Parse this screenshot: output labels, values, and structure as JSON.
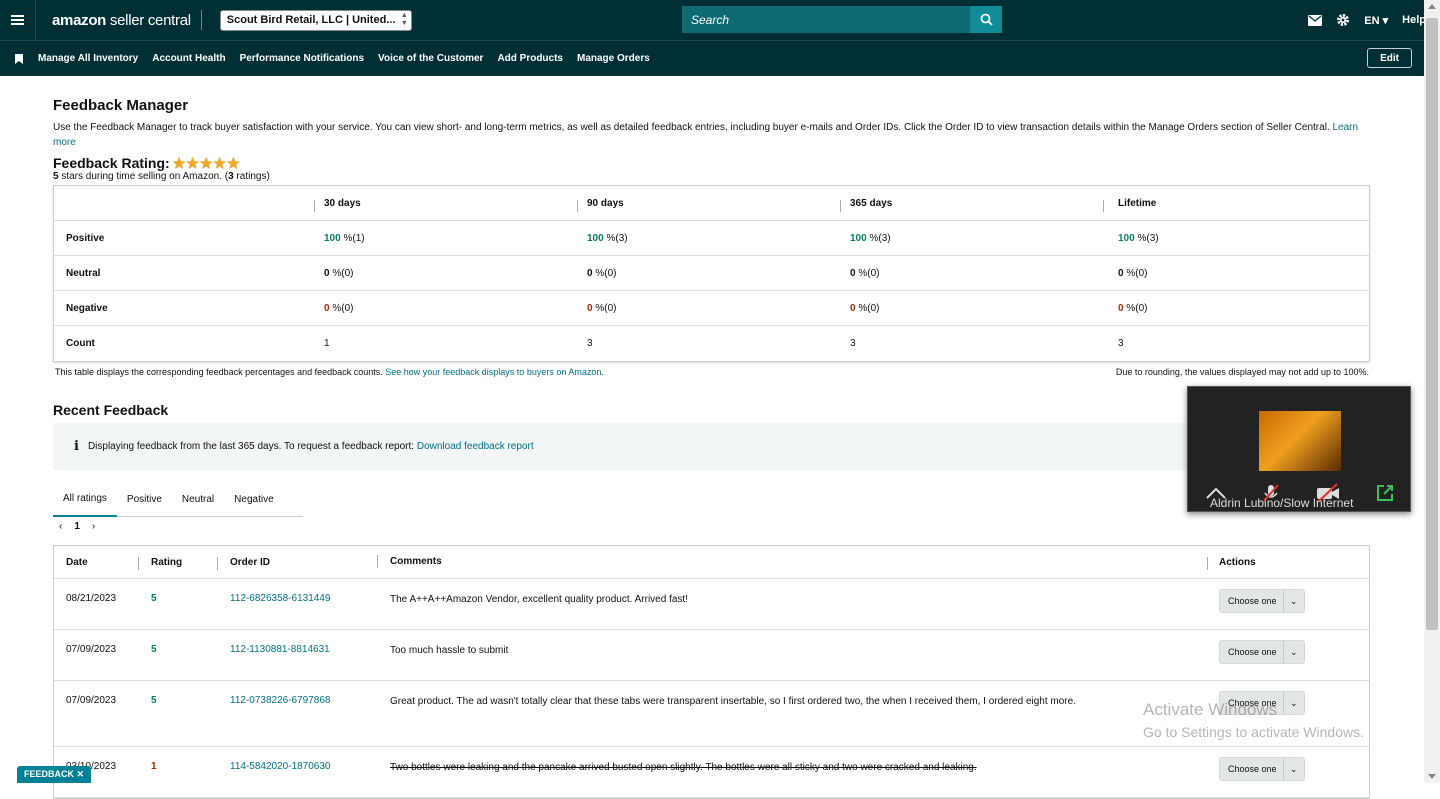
{
  "topbar": {
    "logo_bold": "amazon",
    "logo_light": " seller central",
    "account": "Scout Bird Retail, LLC | United...",
    "search_placeholder": "Search",
    "lang": "EN",
    "help": "Help"
  },
  "nav": {
    "items": [
      "Manage All Inventory",
      "Account Health",
      "Performance Notifications",
      "Voice of the Customer",
      "Add Products",
      "Manage Orders"
    ],
    "edit": "Edit"
  },
  "page": {
    "title": "Feedback Manager",
    "description": "Use the Feedback Manager to track buyer satisfaction with your service. You can view short- and long-term metrics, as well as detailed feedback entries, including buyer e-mails and Order IDs. Click the Order ID to view transaction details within the Manage Orders section of Seller Central.",
    "learn_more": "Learn more"
  },
  "rating": {
    "title": "Feedback Rating:",
    "stars": 5,
    "sub_bold": "5",
    "sub_text": " stars during time selling on Amazon. (",
    "sub_count": "3",
    "sub_end": " ratings)"
  },
  "rating_table": {
    "columns": [
      "30 days",
      "90 days",
      "365 days",
      "Lifetime"
    ],
    "rows": [
      {
        "label": "Positive",
        "cells": [
          {
            "v": "100",
            "s": " %(1)"
          },
          {
            "v": "100",
            "s": " %(3)"
          },
          {
            "v": "100",
            "s": " %(3)"
          },
          {
            "v": "100",
            "s": " %(3)"
          }
        ]
      },
      {
        "label": "Neutral",
        "cells": [
          {
            "v": "0",
            "s": " %(0)"
          },
          {
            "v": "0",
            "s": " %(0)"
          },
          {
            "v": "0",
            "s": " %(0)"
          },
          {
            "v": "0",
            "s": " %(0)"
          }
        ]
      },
      {
        "label": "Negative",
        "cells": [
          {
            "v": "0",
            "s": " %(0)"
          },
          {
            "v": "0",
            "s": " %(0)"
          },
          {
            "v": "0",
            "s": " %(0)"
          },
          {
            "v": "0",
            "s": " %(0)"
          }
        ]
      },
      {
        "label": "Count",
        "cells": [
          {
            "v": "1",
            "s": ""
          },
          {
            "v": "3",
            "s": ""
          },
          {
            "v": "3",
            "s": ""
          },
          {
            "v": "3",
            "s": ""
          }
        ]
      }
    ],
    "note_left": "This table displays the corresponding feedback percentages and feedback counts.",
    "note_link": "See how your feedback displays to buyers on Amazon.",
    "note_right": "Due to rounding, the values displayed may not add up to 100%."
  },
  "recent": {
    "title": "Recent Feedback",
    "info_text": "Displaying feedback from the last 365 days. To request a feedback report:",
    "info_link": "Download feedback report",
    "tabs": [
      "All ratings",
      "Positive",
      "Neutral",
      "Negative"
    ],
    "page": "1",
    "columns": [
      "Date",
      "Rating",
      "Order ID",
      "Comments",
      "Actions"
    ],
    "rows": [
      {
        "date": "08/21/2023",
        "rating": "5",
        "order": "112-6826358-6131449",
        "comment": "The A++A++Amazon Vendor, excellent quality product. Arrived fast!",
        "action": "Choose one"
      },
      {
        "date": "07/09/2023",
        "rating": "5",
        "order": "112-1130881-8814631",
        "comment": "Too much hassle to submit",
        "action": "Choose one"
      },
      {
        "date": "07/09/2023",
        "rating": "5",
        "order": "112-0738226-6797868",
        "comment": "Great product. The ad wasn't totally clear that these tabs were transparent insertable, so I first ordered two, the when I received them, I ordered eight more.",
        "action": "Choose one"
      },
      {
        "date": "03/10/2023",
        "rating": "1",
        "order": "114-5842020-1870630",
        "comment": "Two bottles were leaking and the pancake arrived busted open slightly. The bottles were all sticky and two were cracked and leaking.",
        "action": "Choose one"
      }
    ]
  },
  "overlay": {
    "video_name": "Aldrin Lubino/Slow Internet",
    "watermark_title": "Activate Windows",
    "watermark_sub": "Go to Settings to activate Windows.",
    "feedback_tab": "FEEDBACK ✕"
  },
  "colors": {
    "header": "#002f36",
    "link": "#007185",
    "positive": "#067d62",
    "negative": "#b12704",
    "star": "#f5a623"
  }
}
